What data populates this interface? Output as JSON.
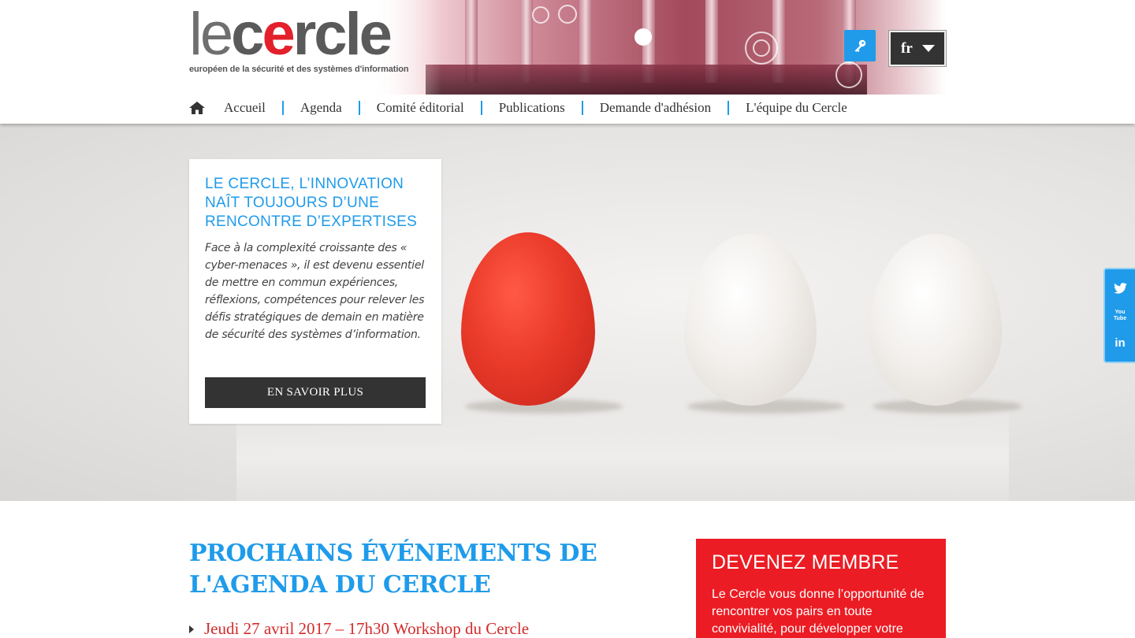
{
  "logo": {
    "word_thin": "le",
    "word_c": "c",
    "word_e": "e",
    "word_rest": "rcle",
    "subtitle": "européen de la sécurité et des systèmes d'information"
  },
  "header": {
    "login_icon": "key-icon",
    "language": "fr"
  },
  "nav": {
    "home_icon": "home-icon",
    "items": [
      {
        "label": "Accueil"
      },
      {
        "label": "Agenda"
      },
      {
        "label": "Comité éditorial"
      },
      {
        "label": "Publications"
      },
      {
        "label": "Demande d'adhésion"
      },
      {
        "label": "L'équipe du Cercle"
      }
    ]
  },
  "hero": {
    "title": "Le Cercle, l’innovation naît toujours d’une rencontre d’expertises",
    "text": "Face à la complexité croissante des « cyber-menaces », il est devenu essentiel de mettre en commun expériences, réflexions, compétences pour relever les défis stratégiques de demain en matière de sécurité des systèmes d’information.",
    "button": "EN SAVOIR PLUS"
  },
  "social": {
    "twitter_icon": "twitter-icon",
    "youtube_label_top": "You",
    "youtube_label_bottom": "Tube",
    "linkedin_label": "in"
  },
  "events": {
    "title": "PROCHAINS ÉVÉNEMENTS DE L'AGENDA DU CERCLE",
    "items": [
      {
        "label": "Jeudi 27 avril 2017 – 17h30 Workshop du Cercle"
      }
    ]
  },
  "member": {
    "title": "DEVENEZ MEMBRE",
    "text": "Le Cercle vous donne l’opportunité de rencontrer vos pairs en toute convivialité, pour développer votre"
  },
  "colors": {
    "accent_blue": "#1f9bea",
    "brand_red": "#ec1c24",
    "dark": "#333333"
  }
}
